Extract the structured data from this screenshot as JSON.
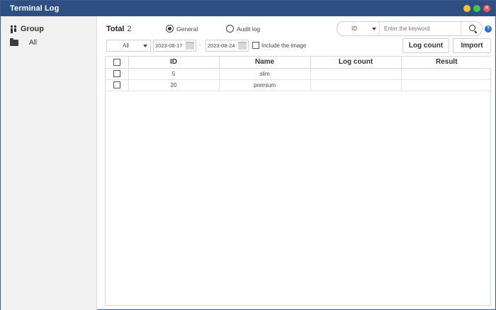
{
  "window": {
    "title": "Terminal Log"
  },
  "sidebar": {
    "group_label": "Group",
    "items": [
      {
        "label": "All"
      }
    ]
  },
  "toolbar": {
    "total_label": "Total",
    "total_count": "2",
    "radios": [
      {
        "label": "General",
        "selected": true
      },
      {
        "label": "Audit log",
        "selected": false
      }
    ],
    "search": {
      "field": "ID",
      "placeholder": "Enter the keyword"
    },
    "filter": "All",
    "date_from": "2023-08-17",
    "date_to": "2023-08-24",
    "date_separator": "-",
    "include_image_label": "Include the image",
    "log_count_button": "Log count",
    "import_button": "Import"
  },
  "table": {
    "columns": [
      "ID",
      "Name",
      "Log count",
      "Result"
    ],
    "rows": [
      {
        "id": "5",
        "name": "slim",
        "log_count": "",
        "result": ""
      },
      {
        "id": "20",
        "name": "premium",
        "log_count": "",
        "result": ""
      }
    ]
  },
  "colors": {
    "titlebar": "#2e4f81",
    "help_icon": "#2a6fc9"
  },
  "icons": [
    "group-icon",
    "folder-icon",
    "search-icon",
    "help-icon",
    "calendar-icon",
    "minimize-icon",
    "maximize-icon",
    "close-icon"
  ]
}
